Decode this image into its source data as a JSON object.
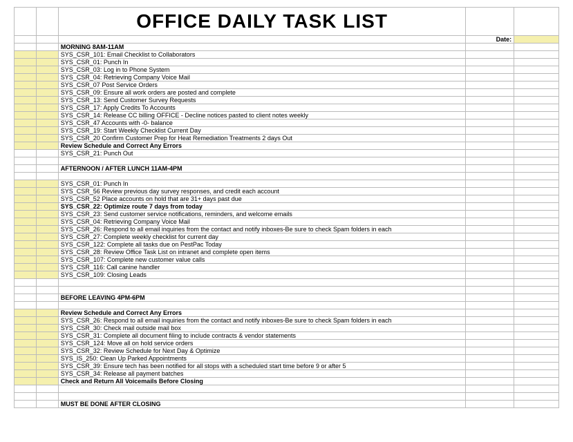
{
  "title": "OFFICE DAILY TASK LIST",
  "date_label": "Date:",
  "sections": {
    "morning": {
      "header": "MORNING 8AM-11AM",
      "items": [
        "SYS_CSR_101:  Email Checklist to Collaborators",
        "SYS_CSR_01:  Punch In",
        "SYS_CSR_03:  Log in to Phone System",
        "SYS_CSR_04:  Retrieving Company Voice Mail",
        "SYS_CSR_07 Post Service Orders",
        "SYS_CSR_09:  Ensure all work orders are posted and complete",
        "SYS_CSR_13:  Send Customer Survey Requests",
        "SYS_CSR_17: Apply Credits To Accounts",
        "SYS_CSR_14: Release CC billing OFFICE - Decline notices pasted to client notes weekly",
        "SYS_CSR_47 Accounts with -0- balance",
        "SYS_CSR_19:  Start Weekly Checklist Current Day",
        "SYS_CSR_20  Confirm Customer Prep for Heat Remediation Treatments 2 days Out"
      ],
      "review": "Review Schedule and Correct Any Errors",
      "punch_out": "SYS_CSR_21:  Punch Out"
    },
    "afternoon": {
      "header": "AFTERNOON / AFTER LUNCH 11AM-4PM",
      "items_pre_bold": [
        "SYS_CSR_01:  Punch In",
        "SYS_CSR_56 Review previous day survey responses, and credit each account",
        "SYS_CSR_52 Place accounts on hold that are 31+ days past due"
      ],
      "bold_item": "SYS_CSR_22: Optimize route 7 days from today",
      "items_post_bold": [
        "SYS_CSR_23: Send customer service notifications, reminders, and welcome emails",
        "SYS_CSR_04:  Retrieving Company Voice Mail",
        "SYS_CSR_26: Respond to all email inquiries from the contact and notify inboxes-Be sure to check Spam folders in each",
        "SYS_CSR_27: Complete weekly checklist for current day",
        "SYS_CSR_122: Complete all tasks due on PestPac Today",
        "SYS_CSR_28: Review Office Task List on intranet and complete open items",
        "SYS_CSR_107: Complete new customer value calls",
        "SYS_CSR_116: Call canine handler",
        "SYS_CSR_109: Closing Leads"
      ]
    },
    "before_leaving": {
      "header": "BEFORE LEAVING 4PM-6PM",
      "review": "Review Schedule and Correct Any Errors",
      "items": [
        "SYS_CSR_26: Respond to all email inquiries from the contact and notify inboxes-Be sure to check Spam folders in each",
        "SYS_CSR_30:  Check mail outside mail box",
        "SYS_CSR_31:  Complete all document filing to include contracts & vendor statements",
        "SYS_CSR_124:  Move all on hold service orders",
        "SYS_CSR_32:  Review Schedule for Next Day & Optimize",
        "SYS_IS_250: Clean Up Parked Appointments",
        "SYS_CSR_39: Ensure tech has been notified for all stops with a scheduled start time before 9 or after 5",
        "SYS_CSR_34:  Release all payment batches"
      ],
      "check_return": "Check and Return All Voicemails Before Closing"
    },
    "after_closing": {
      "header": "MUST BE DONE AFTER CLOSING"
    }
  }
}
